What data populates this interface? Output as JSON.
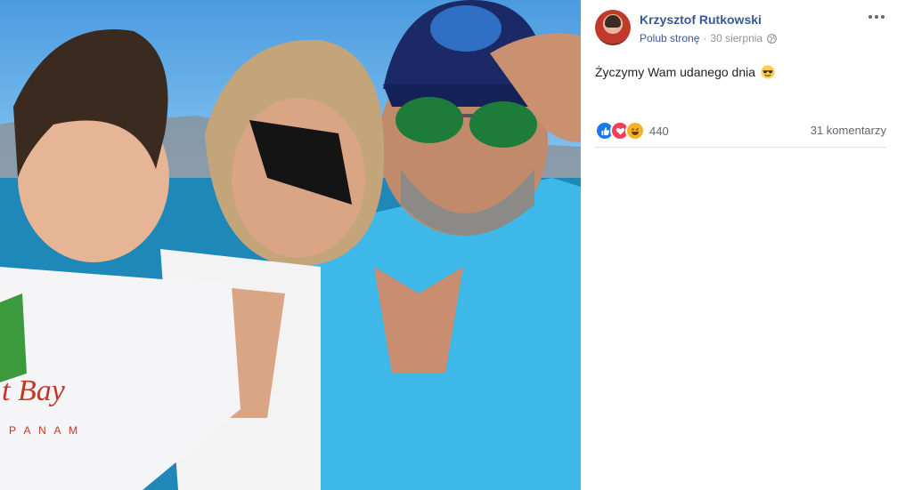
{
  "post": {
    "author": "Krzysztof Rutkowski",
    "like_page": "Polub stronę",
    "separator": "·",
    "date": "30 sierpnia",
    "text": "Życzymy Wam udanego dnia",
    "reaction_count": "440",
    "comments": "31 komentarzy"
  },
  "icons": {
    "privacy": "globe-icon",
    "more": "more-options-icon",
    "emoji": "sunglasses-emoji-icon",
    "reactions": [
      "like-reaction-icon",
      "love-reaction-icon",
      "haha-reaction-icon"
    ]
  },
  "colors": {
    "link": "#385898",
    "like": "#1877f2",
    "love": "#f33e58",
    "haha": "#f7b125"
  }
}
